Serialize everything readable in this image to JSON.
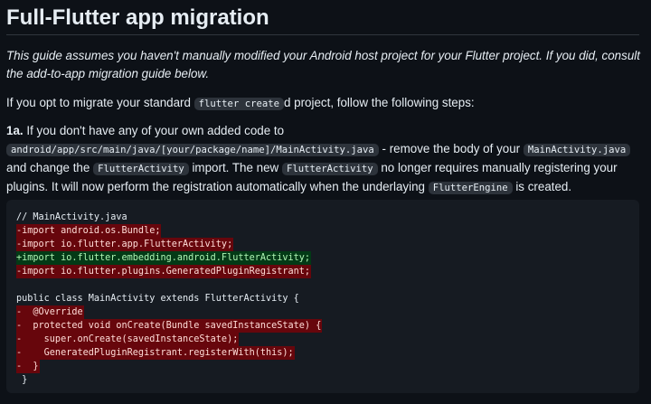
{
  "title": "Full-Flutter app migration",
  "intro": "This guide assumes you haven't manually modified your Android host project for your Flutter project. If you did, consult the add-to-app migration guide below.",
  "opt": {
    "before": "If you opt to migrate your standard ",
    "code": "flutter create",
    "after": "d project, follow the following steps:"
  },
  "step": {
    "num": "1a.",
    "t1": " If you don't have any of your own added code to ",
    "c1": "android/app/src/main/java/[your/package/name]/MainActivity.java",
    "t2": " - remove the body of your ",
    "c2": "MainActivity.java",
    "t3": " and change the ",
    "c3": "FlutterActivity",
    "t4": " import. The new ",
    "c4": "FlutterActivity",
    "t5": " no longer requires manually registering your plugins. It will now perform the registration automatically when the underlaying ",
    "c5": "FlutterEngine",
    "t6": " is created."
  },
  "code": {
    "lines": [
      {
        "text": "// MainActivity.java",
        "kind": "ctx"
      },
      {
        "text": "-import android.os.Bundle;",
        "kind": "del"
      },
      {
        "text": "-import io.flutter.app.FlutterActivity;",
        "kind": "del"
      },
      {
        "text": "+import io.flutter.embedding.android.FlutterActivity;",
        "kind": "add"
      },
      {
        "text": "-import io.flutter.plugins.GeneratedPluginRegistrant;",
        "kind": "del"
      },
      {
        "text": "",
        "kind": "ctx"
      },
      {
        "text": "public class MainActivity extends FlutterActivity {",
        "kind": "ctx"
      },
      {
        "text": "-  @Override",
        "kind": "del"
      },
      {
        "text": "-  protected void onCreate(Bundle savedInstanceState) {",
        "kind": "del"
      },
      {
        "text": "-    super.onCreate(savedInstanceState);",
        "kind": "del"
      },
      {
        "text": "-    GeneratedPluginRegistrant.registerWith(this);",
        "kind": "del"
      },
      {
        "text": "-  }",
        "kind": "del"
      },
      {
        "text": " }",
        "kind": "ctx"
      }
    ]
  }
}
